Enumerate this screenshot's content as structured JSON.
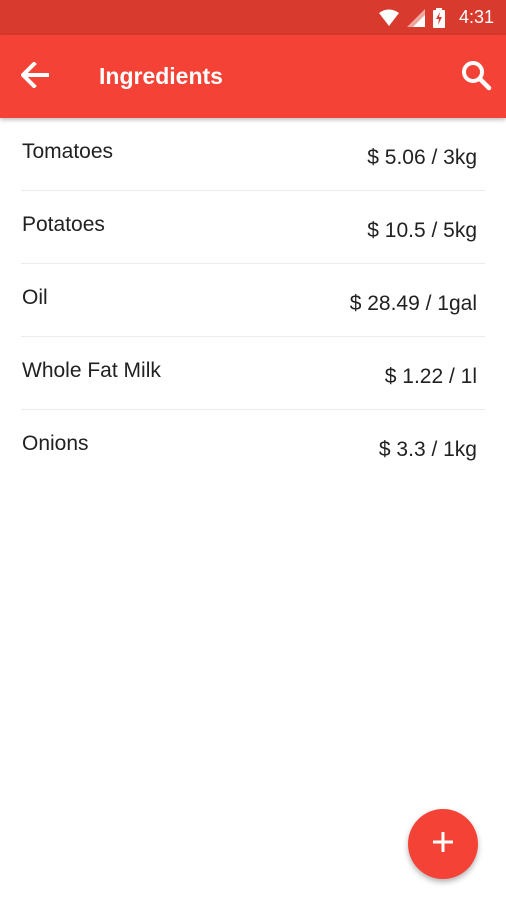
{
  "status_bar": {
    "time": "4:31",
    "icons": [
      "wifi-icon",
      "signal-icon",
      "battery-charging-icon"
    ]
  },
  "app_bar": {
    "title": "Ingredients",
    "back_icon": "arrow-left-icon",
    "search_icon": "search-icon"
  },
  "ingredients": [
    {
      "name": "Tomatoes",
      "price": "$ 5.06 / 3kg"
    },
    {
      "name": "Potatoes",
      "price": "$ 10.5 / 5kg"
    },
    {
      "name": "Oil",
      "price": "$ 28.49 / 1gal"
    },
    {
      "name": "Whole Fat Milk",
      "price": "$ 1.22 / 1l"
    },
    {
      "name": "Onions",
      "price": "$ 3.3 / 1kg"
    }
  ],
  "fab": {
    "icon": "plus-icon"
  },
  "colors": {
    "primary": "#f44336",
    "primary_dark": "#d83a2d",
    "text": "#212121"
  }
}
